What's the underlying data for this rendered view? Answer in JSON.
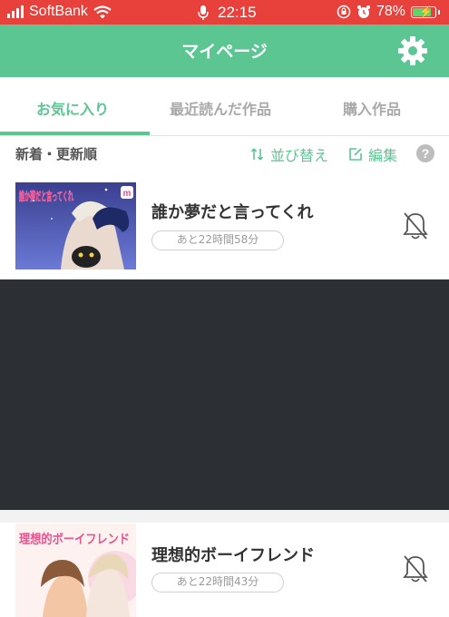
{
  "status_bar": {
    "carrier": "SoftBank",
    "time": "22:15",
    "battery": "78%"
  },
  "header": {
    "title": "マイページ",
    "settings_icon": "gear-icon"
  },
  "tabs": [
    {
      "label": "お気に入り",
      "active": true
    },
    {
      "label": "最近読んだ作品",
      "active": false
    },
    {
      "label": "購入作品",
      "active": false
    }
  ],
  "toolbar": {
    "sort_order": "新着・更新順",
    "sort_button": "並び替え",
    "edit_button": "編集",
    "help": "?"
  },
  "items": [
    {
      "title": "誰か夢だと言ってくれ",
      "badge": "あと22時間58分",
      "cover_text": "誰か夢だと言ってくれ",
      "bell_icon": "bell-off-icon"
    },
    {
      "title": "理想的ボーイフレンド",
      "badge": "あと22時間43分",
      "cover_text": "理想的ボーイフレンド",
      "bell_icon": "bell-off-icon"
    }
  ],
  "colors": {
    "accent": "#5cc693",
    "status_bar": "#e8403a",
    "overlay": "#2c3034"
  }
}
